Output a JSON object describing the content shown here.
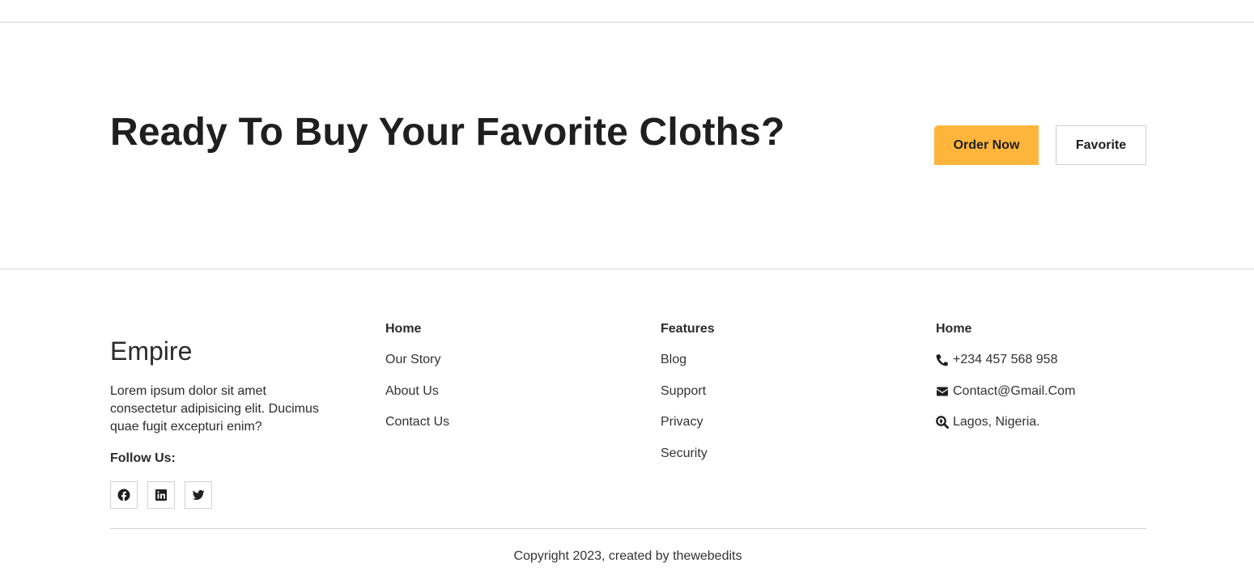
{
  "cta": {
    "title": "Ready To Buy Your Favorite Cloths?",
    "order_label": "Order Now",
    "favorite_label": "Favorite",
    "accent_color": "#ffb53c"
  },
  "footer": {
    "brand": "Empire",
    "description": "Lorem ipsum dolor sit amet consectetur adipisicing elit. Ducimus quae fugit excepturi enim?",
    "follow_label": "Follow Us:",
    "socials": [
      {
        "icon": "facebook-icon"
      },
      {
        "icon": "linkedin-icon"
      },
      {
        "icon": "twitter-icon"
      }
    ],
    "columns": [
      {
        "heading": "Home",
        "items": [
          "Our Story",
          "About Us",
          "Contact Us"
        ]
      },
      {
        "heading": "Features",
        "items": [
          "Blog",
          "Support",
          "Privacy",
          "Security"
        ]
      },
      {
        "heading": "Home",
        "contacts": [
          {
            "icon": "phone-icon",
            "text": "+234 457 568 958"
          },
          {
            "icon": "envelope-icon",
            "text": "Contact@Gmail.Com"
          },
          {
            "icon": "search-location-icon",
            "text": "Lagos, Nigeria."
          }
        ]
      }
    ],
    "copyright": "Copyright 2023, created by thewebedits"
  }
}
